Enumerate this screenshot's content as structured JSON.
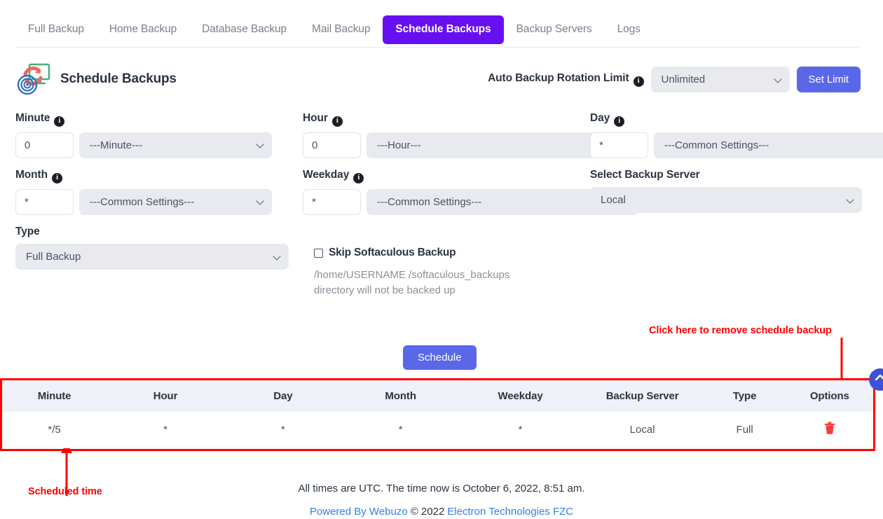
{
  "tabs": [
    {
      "label": "Full Backup",
      "active": false
    },
    {
      "label": "Home Backup",
      "active": false
    },
    {
      "label": "Database Backup",
      "active": false
    },
    {
      "label": "Mail Backup",
      "active": false
    },
    {
      "label": "Schedule Backups",
      "active": true
    },
    {
      "label": "Backup Servers",
      "active": false
    },
    {
      "label": "Logs",
      "active": false
    }
  ],
  "header": {
    "title": "Schedule Backups",
    "icon": "backup-schedule-icon",
    "rotation_label": "Auto Backup Rotation Limit",
    "rotation_value": "Unlimited",
    "set_limit_label": "Set Limit"
  },
  "form": {
    "minute": {
      "label": "Minute",
      "value": "0",
      "select": "---Minute---"
    },
    "hour": {
      "label": "Hour",
      "value": "0",
      "select": "---Hour---"
    },
    "day": {
      "label": "Day",
      "value": "*",
      "select": "---Common Settings---"
    },
    "month": {
      "label": "Month",
      "value": "*",
      "select": "---Common Settings---"
    },
    "weekday": {
      "label": "Weekday",
      "value": "*",
      "select": "---Common Settings---"
    },
    "backup_server": {
      "label": "Select Backup Server",
      "value": "Local"
    },
    "type": {
      "label": "Type",
      "value": "Full Backup"
    },
    "skip": {
      "label": "Skip Softaculous Backup",
      "checked": false,
      "note": "/home/USERNAME /softaculous_backups directory will not be backed up"
    },
    "submit_label": "Schedule"
  },
  "annotations": {
    "remove": "Click here to remove schedule backup",
    "scheduled_time": "Scheduled time",
    "color": "#ff0000"
  },
  "table": {
    "columns": [
      "Minute",
      "Hour",
      "Day",
      "Month",
      "Weekday",
      "Backup Server",
      "Type",
      "Options"
    ],
    "rows": [
      {
        "minute": "*/5",
        "hour": "*",
        "day": "*",
        "month": "*",
        "weekday": "*",
        "backup_server": "Local",
        "type": "Full",
        "options_icon": "trash-icon"
      }
    ]
  },
  "footer": {
    "time_notice": "All times are UTC. The time now is October 6, 2022, 8:51 am.",
    "powered_by": "Powered By Webuzo",
    "copyright": "© 2022",
    "company": "Electron Technologies FZC"
  },
  "colors": {
    "accent_purple": "#6610f2",
    "button_blue": "#5a67e8",
    "annotation_red": "#ff0000",
    "trash_red": "#fb3a3a",
    "link_blue": "#2f80ed"
  },
  "scroll_top": {
    "icon": "chevron-up-icon"
  }
}
